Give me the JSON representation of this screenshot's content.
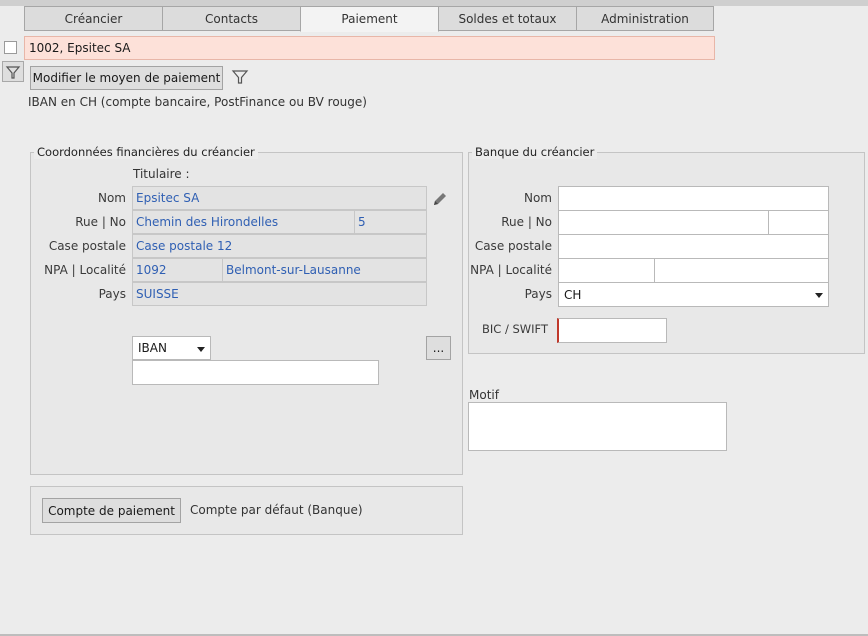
{
  "tabs": [
    {
      "label": "Créancier"
    },
    {
      "label": "Contacts"
    },
    {
      "label": "Paiement"
    },
    {
      "label": "Soldes et totaux"
    },
    {
      "label": "Administration"
    }
  ],
  "creditor": {
    "title": "1002, Epsitec SA"
  },
  "payment_method": {
    "button_label": "Modifier le moyen de paiement",
    "description": "IBAN en CH (compte bancaire, PostFinance ou BV rouge)"
  },
  "financial": {
    "group_title": "Coordonnées financières du créancier",
    "holder_label": "Titulaire :",
    "labels": {
      "name": "Nom",
      "street": "Rue | No",
      "pobox": "Case postale",
      "npa_city": "NPA | Localité",
      "country": "Pays"
    },
    "values": {
      "name": "Epsitec SA",
      "street": "Chemin des Hirondelles",
      "street_no": "5",
      "pobox": "Case postale 12",
      "npa": "1092",
      "city": "Belmont-sur-Lausanne",
      "country": "SUISSE"
    },
    "account_type": "IBAN",
    "account_value": "",
    "more_button": "..."
  },
  "bank": {
    "group_title": "Banque du créancier",
    "labels": {
      "name": "Nom",
      "street": "Rue | No",
      "pobox": "Case postale",
      "npa_city": "NPA | Localité",
      "country": "Pays",
      "bic": "BIC / SWIFT"
    },
    "values": {
      "name": "",
      "street": "",
      "street_no": "",
      "pobox": "",
      "npa": "",
      "city": "",
      "country": "CH",
      "bic": ""
    }
  },
  "motif": {
    "label": "Motif",
    "value": ""
  },
  "payment_account": {
    "button_label": "Compte de paiement",
    "value": "Compte par défaut (Banque)"
  },
  "colors": {
    "creditor_bar": "#fde1d9",
    "readonly_text": "#2f5fb3",
    "bic_accent": "#c0392b"
  }
}
